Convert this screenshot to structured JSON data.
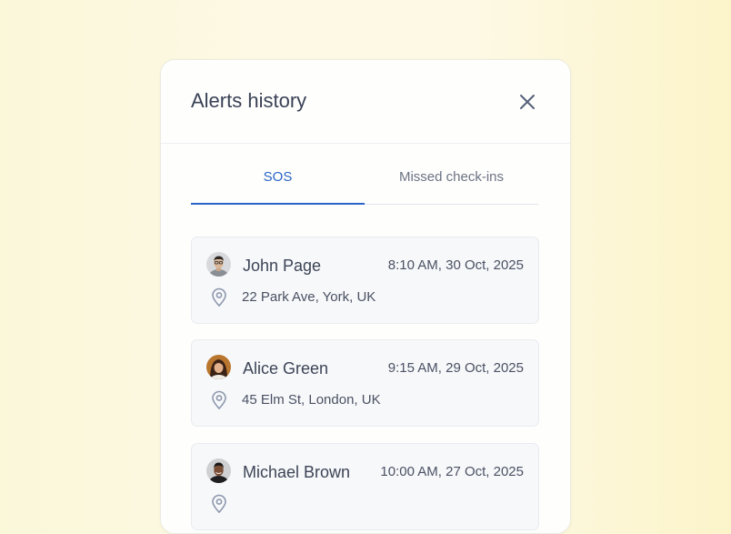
{
  "dialog": {
    "title": "Alerts history",
    "close_icon": "close-icon"
  },
  "tabs": [
    {
      "label": "SOS",
      "active": true
    },
    {
      "label": "Missed check-ins",
      "active": false
    }
  ],
  "alerts": [
    {
      "name": "John Page",
      "time": "8:10 AM, 30 Oct, 2025",
      "address": "22 Park Ave, York, UK"
    },
    {
      "name": "Alice Green",
      "time": "9:15 AM, 29 Oct, 2025",
      "address": "45 Elm St, London, UK"
    },
    {
      "name": "Michael Brown",
      "time": "10:00 AM, 27 Oct, 2025",
      "address": ""
    }
  ],
  "colors": {
    "accent": "#2a64c9",
    "background": "#fdf9e4"
  }
}
